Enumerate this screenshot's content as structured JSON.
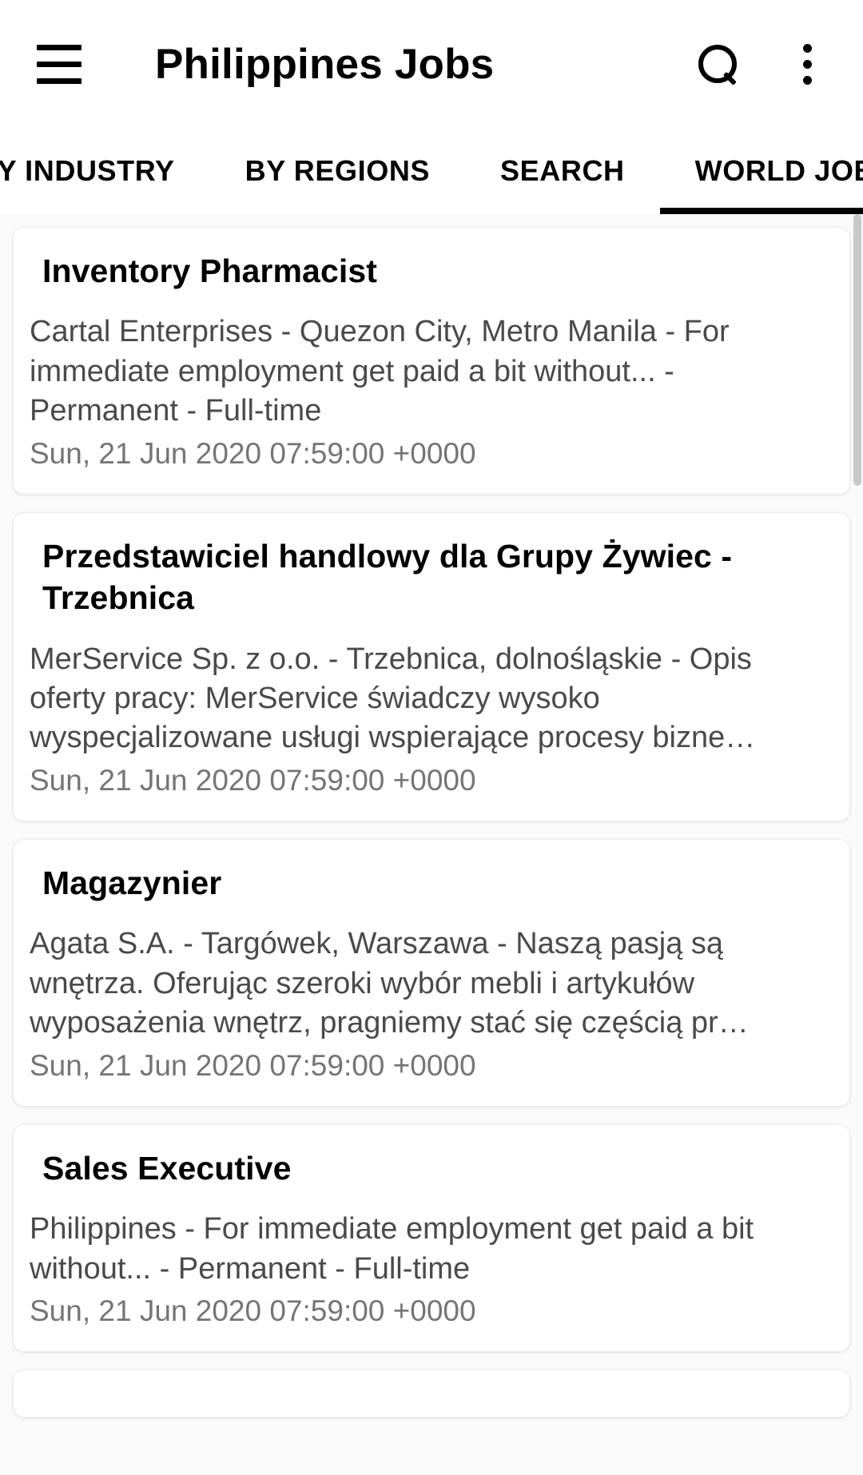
{
  "appbar": {
    "menu_icon": "hamburger-menu-icon",
    "title": "Philippines Jobs",
    "search_icon": "search-icon",
    "overflow_icon": "more-vert-icon"
  },
  "tabs": [
    {
      "label": "BY INDUSTRY",
      "active": false
    },
    {
      "label": "BY REGIONS",
      "active": false
    },
    {
      "label": "SEARCH",
      "active": false
    },
    {
      "label": "WORLD JOBS",
      "active": true
    }
  ],
  "active_tab": "WORLD JOBS",
  "colors": {
    "accent": "#000000",
    "page_background": "#fafafa",
    "card_background": "#ffffff",
    "title_text": "#000000",
    "description_text": "#4a4a4a",
    "date_text": "#757575"
  },
  "jobs": [
    {
      "title": "Inventory Pharmacist",
      "description": "Cartal Enterprises - Quezon City, Metro Manila - For immediate employment get paid a bit without... - Permanent - Full-time",
      "date": "Sun, 21 Jun 2020 07:59:00 +0000"
    },
    {
      "title": "Przedstawiciel handlowy dla Grupy Żywiec - Trzebnica",
      "description": "MerService Sp. z o.o. - Trzebnica, dolnośląskie - Opis oferty pracy: MerService świadczy wysoko wyspecjalizowane usługi wspierające procesy bizne…",
      "date": "Sun, 21 Jun 2020 07:59:00 +0000"
    },
    {
      "title": "Magazynier",
      "description": "Agata S.A. - Targówek, Warszawa - Naszą pasją są wnętrza. Oferując szeroki wybór mebli i artykułów wyposażenia wnętrz, pragniemy stać się częścią pr…",
      "date": "Sun, 21 Jun 2020 07:59:00 +0000"
    },
    {
      "title": "Sales Executive",
      "description": "Philippines - For immediate employment get paid a bit without... - Permanent - Full-time",
      "date": "Sun, 21 Jun 2020 07:59:00 +0000"
    },
    {
      "title": "",
      "description": "",
      "date": ""
    }
  ]
}
